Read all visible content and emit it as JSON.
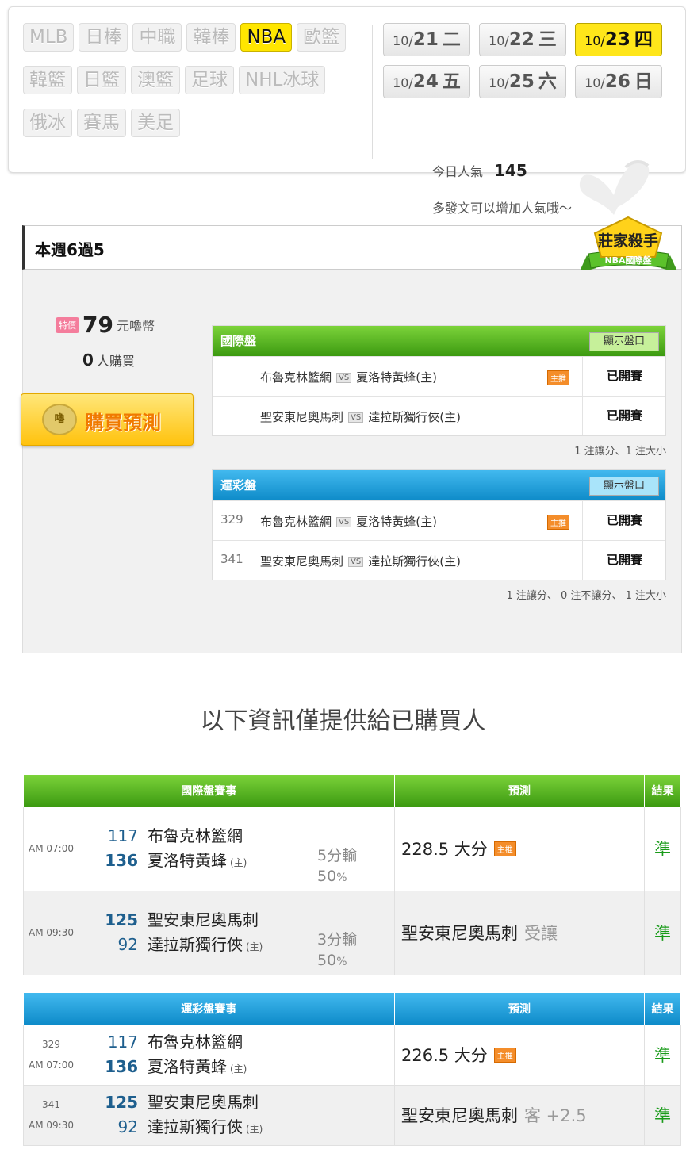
{
  "sports": [
    {
      "label": "MLB",
      "active": false
    },
    {
      "label": "日棒",
      "active": false
    },
    {
      "label": "中職",
      "active": false
    },
    {
      "label": "韓棒",
      "active": false
    },
    {
      "label": "NBA",
      "active": true
    },
    {
      "label": "歐籃",
      "active": false
    },
    {
      "label": "韓籃",
      "active": false
    },
    {
      "label": "日籃",
      "active": false
    },
    {
      "label": "澳籃",
      "active": false
    },
    {
      "label": "足球",
      "active": false
    },
    {
      "label": "NHL冰球",
      "active": false
    },
    {
      "label": "俄冰",
      "active": false
    },
    {
      "label": "賽馬",
      "active": false
    },
    {
      "label": "美足",
      "active": false
    }
  ],
  "dates": [
    {
      "month": "10/",
      "day": "21",
      "weekday": "二",
      "active": false
    },
    {
      "month": "10/",
      "day": "22",
      "weekday": "三",
      "active": false
    },
    {
      "month": "10/",
      "day": "23",
      "weekday": "四",
      "active": true
    },
    {
      "month": "10/",
      "day": "24",
      "weekday": "五",
      "active": false
    },
    {
      "month": "10/",
      "day": "25",
      "weekday": "六",
      "active": false
    },
    {
      "month": "10/",
      "day": "26",
      "weekday": "日",
      "active": false
    }
  ],
  "popularity": {
    "label": "今日人氣",
    "value": "145",
    "note": "多發文可以增加人氣哦～"
  },
  "week_record": "本週6過5",
  "badge": {
    "title": "莊家殺手",
    "subtitle": "NBA國際盤"
  },
  "price": {
    "tag": "特價",
    "amount": "79",
    "unit": "元嚕幣"
  },
  "buyers": {
    "count": "0",
    "label": "人購買"
  },
  "buy_button": {
    "icon_text": "嚕",
    "label": "購買預測"
  },
  "vs_label": "VS",
  "main_tag": "主推",
  "intl_panel": {
    "title": "國際盤",
    "show_label": "顯示盤口",
    "rows": [
      {
        "num": "",
        "away": "布魯克林籃網",
        "home": "夏洛特黃蜂(主)",
        "main": true,
        "status": "已開賽"
      },
      {
        "num": "",
        "away": "聖安東尼奧馬刺",
        "home": "達拉斯獨行俠(主)",
        "main": false,
        "status": "已開賽"
      }
    ],
    "note": "1 注讓分、1 注大小"
  },
  "lottery_panel": {
    "title": "運彩盤",
    "show_label": "顯示盤口",
    "rows": [
      {
        "num": "329",
        "away": "布魯克林籃網",
        "home": "夏洛特黃蜂(主)",
        "main": true,
        "status": "已開賽"
      },
      {
        "num": "341",
        "away": "聖安東尼奧馬刺",
        "home": "達拉斯獨行俠(主)",
        "main": false,
        "status": "已開賽"
      }
    ],
    "note": "1 注讓分、 0 注不讓分、 1 注大小"
  },
  "info_text": "以下資訊僅提供給已購買人",
  "host_mark": "(主)",
  "intl_table": {
    "headers": {
      "game": "國際盤賽事",
      "pred": "預測",
      "result": "結果"
    },
    "rows": [
      {
        "num": "",
        "time": "AM 07:00",
        "away_score": "117",
        "away": "布魯克林籃網",
        "home_score": "136",
        "home": "夏洛特黃蜂",
        "spread": "5分輸",
        "pct": "50",
        "pct_unit": "%",
        "pred_main": "228.5 大分",
        "pred_extra": "",
        "main": true,
        "result": "準"
      },
      {
        "num": "",
        "time": "AM 09:30",
        "away_score": "125",
        "away": "聖安東尼奧馬刺",
        "home_score": "92",
        "home": "達拉斯獨行俠",
        "spread": "3分輸",
        "pct": "50",
        "pct_unit": "%",
        "pred_main": "聖安東尼奧馬刺",
        "pred_extra": "受讓",
        "main": false,
        "result": "準"
      }
    ]
  },
  "lottery_table": {
    "headers": {
      "game": "運彩盤賽事",
      "pred": "預測",
      "result": "結果"
    },
    "rows": [
      {
        "num": "329",
        "time": "AM 07:00",
        "away_score": "117",
        "away": "布魯克林籃網",
        "home_score": "136",
        "home": "夏洛特黃蜂",
        "pred_main": "226.5 大分",
        "pred_extra": "",
        "main": true,
        "result": "準"
      },
      {
        "num": "341",
        "time": "AM 09:30",
        "away_score": "125",
        "away": "聖安東尼奧馬刺",
        "home_score": "92",
        "home": "達拉斯獨行俠",
        "pred_main": "聖安東尼奧馬刺",
        "pred_extra": "客 +2.5",
        "main": false,
        "result": "準"
      }
    ]
  }
}
